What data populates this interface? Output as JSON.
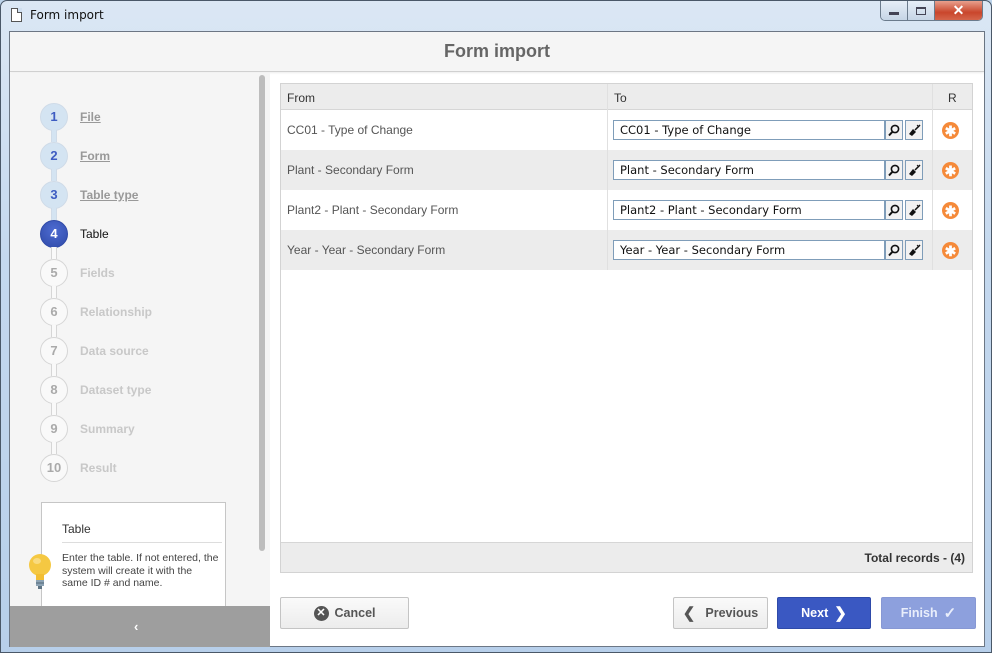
{
  "window": {
    "title": "Form import",
    "controls": {
      "minimize": "minimize",
      "maximize": "maximize",
      "close": "✕"
    }
  },
  "header": {
    "title": "Form import"
  },
  "steps": [
    {
      "num": "1",
      "label": "File",
      "state": "done"
    },
    {
      "num": "2",
      "label": "Form",
      "state": "done"
    },
    {
      "num": "3",
      "label": "Table type",
      "state": "done"
    },
    {
      "num": "4",
      "label": "Table",
      "state": "active"
    },
    {
      "num": "5",
      "label": "Fields",
      "state": "pending"
    },
    {
      "num": "6",
      "label": "Relationship",
      "state": "pending"
    },
    {
      "num": "7",
      "label": "Data source",
      "state": "pending"
    },
    {
      "num": "8",
      "label": "Dataset type",
      "state": "pending"
    },
    {
      "num": "9",
      "label": "Summary",
      "state": "pending"
    },
    {
      "num": "10",
      "label": "Result",
      "state": "pending"
    }
  ],
  "tip": {
    "title": "Table",
    "text": "Enter the table. If not entered, the system will create it with the same ID # and name."
  },
  "sidebar": {
    "collapse_glyph": "‹"
  },
  "grid": {
    "columns": {
      "from": "From",
      "to": "To",
      "required": "R"
    },
    "rows": [
      {
        "from": "CC01 - Type of Change",
        "to": "CC01 - Type of Change"
      },
      {
        "from": "Plant - Secondary Form",
        "to": "Plant - Secondary Form"
      },
      {
        "from": "Plant2 - Plant - Secondary Form",
        "to": "Plant2 - Plant - Secondary Form"
      },
      {
        "from": "Year - Year - Secondary Form",
        "to": "Year - Year - Secondary Form"
      }
    ],
    "required_glyph": "✱",
    "footer": "Total records  - (4)"
  },
  "buttons": {
    "cancel": "Cancel",
    "previous": "Previous",
    "next": "Next",
    "finish": "Finish"
  },
  "colors": {
    "primary": "#3a58c2",
    "disabled_primary": "#8da0dd",
    "required": "#f58a3a",
    "step_active": "#3d5cc2"
  }
}
